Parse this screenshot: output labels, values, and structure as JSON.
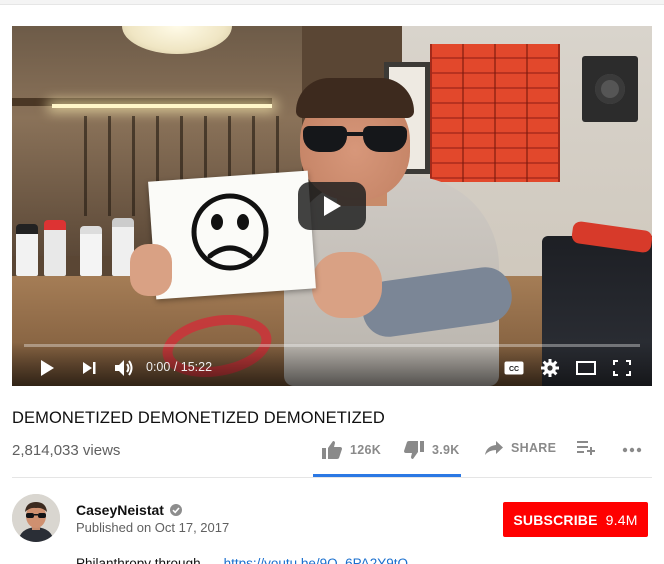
{
  "player": {
    "current_time": "0:00",
    "separator": " / ",
    "duration": "15:22",
    "progress": 0.0,
    "colors": {
      "play_button_bg": "#212121",
      "progress_track": "#ffffff"
    },
    "icons": [
      "play-icon",
      "next-icon",
      "volume-icon",
      "captions-icon",
      "settings-icon",
      "theater-mode-icon",
      "fullscreen-icon"
    ]
  },
  "video": {
    "title": "DEMONETIZED DEMONETIZED DEMONETIZED",
    "views": "2,814,033 views",
    "likes": "126K",
    "dislikes": "3.9K",
    "share_label": "SHARE",
    "like_ratio": 0.97
  },
  "channel": {
    "name": "CaseyNeistat",
    "verified": true,
    "published": "Published on Oct 17, 2017",
    "subscribe_label": "SUBSCRIBE",
    "subscriber_count": "9.4M"
  },
  "description": {
    "text": "Philanthropy through ...",
    "link": "https://youtu.be/9O_6PA2Y9tQ"
  },
  "colors": {
    "subscribe_bg": "#ff0000",
    "sentiment_bar": "#2b78e4",
    "link": "#1a6fce"
  }
}
